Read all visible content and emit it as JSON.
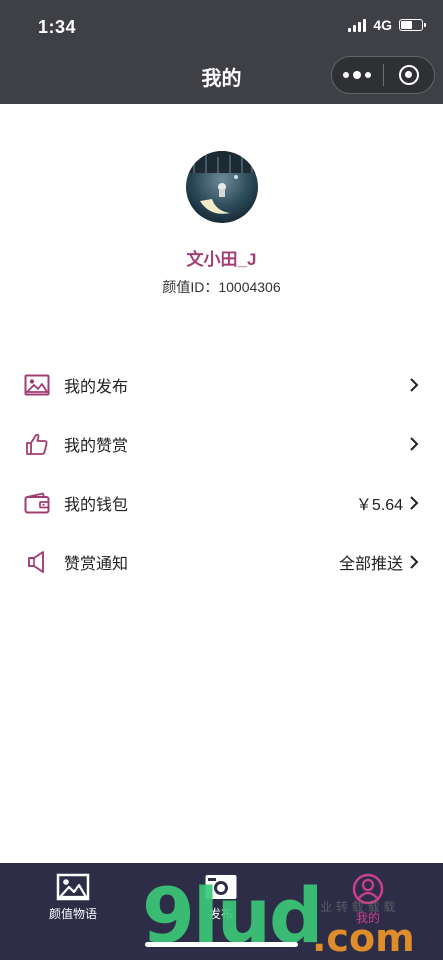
{
  "status_bar": {
    "time": "1:34",
    "network": "4G"
  },
  "nav": {
    "title": "我的"
  },
  "profile": {
    "username": "文小田_J",
    "id_text": "颜值ID：10004306"
  },
  "menu": [
    {
      "label": "我的发布",
      "value": "",
      "icon": "image-icon"
    },
    {
      "label": "我的赞赏",
      "value": "",
      "icon": "thumbs-up-icon"
    },
    {
      "label": "我的钱包",
      "value": "￥5.64",
      "icon": "wallet-icon"
    },
    {
      "label": "赞赏通知",
      "value": "全部推送",
      "icon": "speaker-icon"
    }
  ],
  "tabbar": {
    "items": [
      {
        "label": "颜值物语",
        "icon": "picture-icon"
      },
      {
        "label": "发布",
        "icon": "camera-icon"
      },
      {
        "label": "我的",
        "icon": "user-icon",
        "active": true
      }
    ]
  },
  "watermark": {
    "main": "9lud",
    "domain": ".com",
    "small": "业 转 载 载 载"
  },
  "colors": {
    "accent": "#a23d74",
    "tabbar_bg": "#2e2d47",
    "nav_bg": "#3f4045"
  }
}
